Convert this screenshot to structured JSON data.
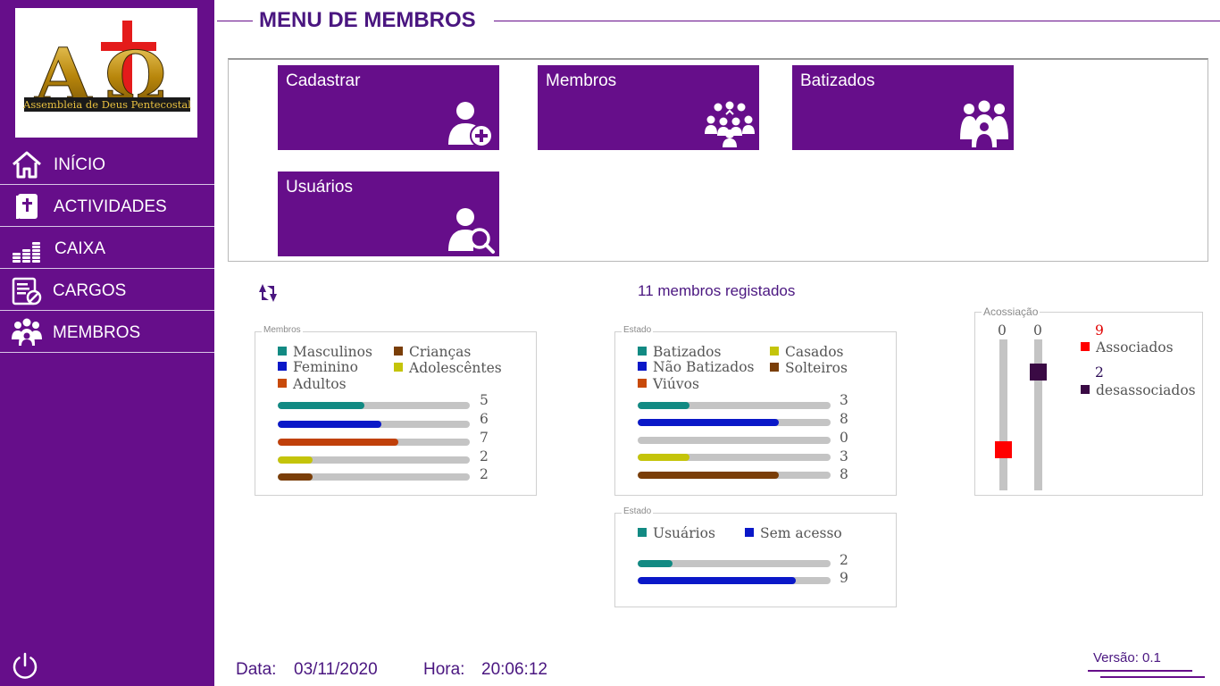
{
  "sidebar": {
    "logo": {
      "text": "Assembleia de Deus Pentecostal",
      "icon": "alpha-omega-cross-logo"
    },
    "items": [
      {
        "label": "INÍCIO",
        "icon": "home-icon"
      },
      {
        "label": "ACTIVIDADES",
        "icon": "bible-icon"
      },
      {
        "label": "CAIXA",
        "icon": "coins-icon"
      },
      {
        "label": "CARGOS",
        "icon": "document-block-icon"
      },
      {
        "label": "MEMBROS",
        "icon": "group-icon"
      }
    ],
    "power_icon": "power-icon"
  },
  "header": {
    "title": "MENU DE MEMBROS"
  },
  "tiles": [
    {
      "label": "Cadastrar",
      "icon": "user-add-icon"
    },
    {
      "label": "Membros",
      "icon": "group-people-icon"
    },
    {
      "label": "Batizados",
      "icon": "family-icon"
    },
    {
      "label": "Usuários",
      "icon": "user-search-icon"
    }
  ],
  "summary": {
    "count_text": "11 membros registados",
    "refresh_icon": "refresh-icon"
  },
  "membros_box": {
    "title": "Membros",
    "legend": [
      {
        "label": "Masculinos",
        "color": "#128a83"
      },
      {
        "label": "Crianças",
        "color": "#7a3e08"
      },
      {
        "label": "Feminino",
        "color": "#0a18c8"
      },
      {
        "label": "Adolescêntes",
        "color": "#c4c40a"
      },
      {
        "label": "Adultos",
        "color": "#c84a0a"
      }
    ],
    "bars": [
      {
        "value": "5",
        "fraction": 0.45,
        "color": "#128a83"
      },
      {
        "value": "6",
        "fraction": 0.54,
        "color": "#0a18c8"
      },
      {
        "value": "7",
        "fraction": 0.63,
        "color": "#c0400a"
      },
      {
        "value": "2",
        "fraction": 0.18,
        "color": "#c4c40a"
      },
      {
        "value": "2",
        "fraction": 0.18,
        "color": "#7a3e08"
      }
    ]
  },
  "estado_box": {
    "title": "Estado",
    "legend": [
      {
        "label": "Batizados",
        "color": "#128a83"
      },
      {
        "label": "Casados",
        "color": "#c4c40a"
      },
      {
        "label": "Não Batizados",
        "color": "#0a18c8"
      },
      {
        "label": "Solteiros",
        "color": "#7a3e08"
      },
      {
        "label": "Viúvos",
        "color": "#c84a0a"
      }
    ],
    "bars": [
      {
        "value": "3",
        "fraction": 0.27,
        "color": "#128a83"
      },
      {
        "value": "8",
        "fraction": 0.73,
        "color": "#0a18c8"
      },
      {
        "value": "0",
        "fraction": 0,
        "color": "#c84a0a"
      },
      {
        "value": "3",
        "fraction": 0.27,
        "color": "#c4c40a"
      },
      {
        "value": "8",
        "fraction": 0.73,
        "color": "#7a3e08"
      }
    ]
  },
  "usuarios_box": {
    "title": "Estado",
    "legend": [
      {
        "label": "Usuários",
        "color": "#128a83"
      },
      {
        "label": "Sem acesso",
        "color": "#0a18c8"
      }
    ],
    "bars": [
      {
        "value": "2",
        "fraction": 0.18,
        "color": "#128a83"
      },
      {
        "value": "9",
        "fraction": 0.82,
        "color": "#0a18c8"
      }
    ]
  },
  "acossiacao_box": {
    "title": "Acossiação",
    "slider1": {
      "value": "0",
      "level": 0.24,
      "color": "#ff0000"
    },
    "slider2": {
      "value": "0",
      "level": 0.82,
      "color": "#3a0a44"
    },
    "associados": {
      "count": "9",
      "label": "Associados",
      "color": "#ff0000",
      "count_color": "#e00000"
    },
    "desassociados": {
      "count": "2",
      "label": "desassociados",
      "color": "#3a0a44",
      "count_color": "#2a0a55"
    }
  },
  "footer": {
    "date_label": "Data:",
    "date_value": "03/11/2020",
    "time_label": "Hora:",
    "time_value": "20:06:12",
    "version": "Versão: 0.1"
  }
}
